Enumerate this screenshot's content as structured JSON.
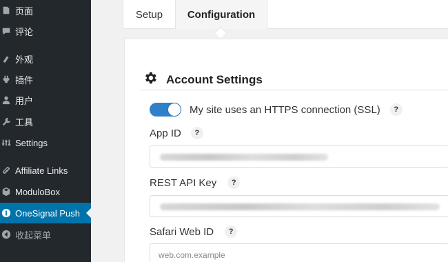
{
  "sidebar": {
    "items": [
      {
        "label": "页面",
        "icon": "pages-icon"
      },
      {
        "label": "评论",
        "icon": "comments-icon"
      },
      {
        "label": "外观",
        "icon": "appearance-icon"
      },
      {
        "label": "插件",
        "icon": "plugins-icon"
      },
      {
        "label": "用户",
        "icon": "users-icon"
      },
      {
        "label": "工具",
        "icon": "tools-icon"
      },
      {
        "label": "Settings",
        "icon": "settings-icon"
      },
      {
        "label": "Affiliate Links",
        "icon": "link-icon"
      },
      {
        "label": "ModuloBox",
        "icon": "box-icon"
      },
      {
        "label": "OneSignal Push",
        "icon": "onesignal-icon",
        "active": true
      },
      {
        "label": "收起菜单",
        "icon": "collapse-icon"
      }
    ]
  },
  "tabs": [
    {
      "label": "Setup"
    },
    {
      "label": "Configuration",
      "active": true
    }
  ],
  "account_settings": {
    "title": "Account Settings",
    "https_toggle": {
      "label": "My site uses an HTTPS connection (SSL)",
      "on": true,
      "help": "?"
    },
    "app_id": {
      "label": "App ID",
      "help": "?",
      "value_hidden": true
    },
    "rest_api_key": {
      "label": "REST API Key",
      "help": "?",
      "value_hidden": true
    },
    "safari_web_id": {
      "label": "Safari Web ID",
      "help": "?",
      "placeholder": "web.com.example"
    }
  },
  "colors": {
    "sidebar_bg": "#23282d",
    "active_bg": "#0073aa",
    "toggle_on": "#2f80c8"
  }
}
